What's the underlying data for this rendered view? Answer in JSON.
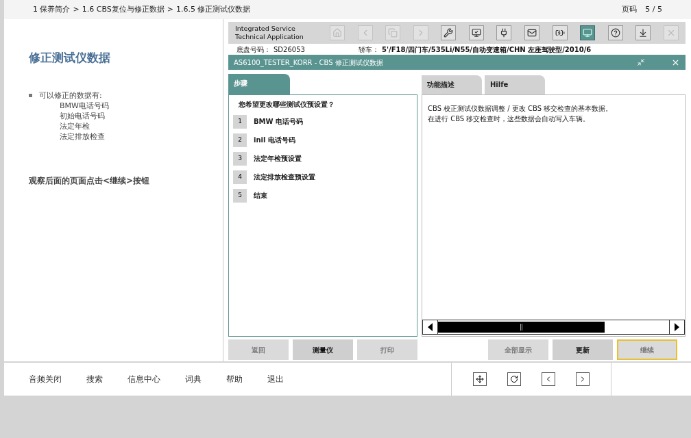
{
  "breadcrumb": [
    "1 保养简介",
    "1.6 CBS复位与修正数据",
    "1.6.5 修正测试仪数据"
  ],
  "breadcrumb_separator": ">",
  "page_label": "页码",
  "page_number": "5 / 5",
  "left": {
    "title": "修正测试仪数据",
    "intro": "可以修正的数据有:",
    "items": [
      "BMW电话号码",
      "初始电话号码",
      "法定年检",
      "法定排放检查"
    ],
    "instruction": "观察后面的页面点击<继续>按钮"
  },
  "app": {
    "brand": [
      "Integrated Service",
      "Technical Application"
    ],
    "toolbar": [
      {
        "kind": "home",
        "disabled": true,
        "selected": false
      },
      {
        "kind": "back",
        "disabled": true,
        "selected": false
      },
      {
        "kind": "copy",
        "disabled": true,
        "selected": false
      },
      {
        "kind": "forward",
        "disabled": true,
        "selected": false
      },
      {
        "kind": "wrench",
        "disabled": false,
        "selected": false
      },
      {
        "kind": "diagnosis",
        "disabled": false,
        "selected": false
      },
      {
        "kind": "plug",
        "disabled": false,
        "selected": false
      },
      {
        "kind": "mail",
        "disabled": false,
        "selected": false
      },
      {
        "kind": "battery",
        "disabled": false,
        "selected": false
      },
      {
        "kind": "screen",
        "disabled": false,
        "selected": true
      },
      {
        "kind": "help",
        "disabled": false,
        "selected": false
      },
      {
        "kind": "download",
        "disabled": false,
        "selected": false
      },
      {
        "kind": "close",
        "disabled": true,
        "selected": false
      }
    ],
    "vin_label": "底盘号码：",
    "vin": "SD26053",
    "vehicle_label": "轿车：",
    "vehicle": "5'/F18/四门车/535Li/N55/自动变速箱/CHN 左座驾驶型/2010/6",
    "dialog_title": "AS6100_TESTER_KORR - CBS 修正测试仪数据",
    "left_tabs": [
      {
        "label": "步骤",
        "selected": true
      }
    ],
    "right_tabs": [
      {
        "label": "功能描述",
        "selected": false
      },
      {
        "label": "Hilfe",
        "selected": false
      }
    ],
    "question": "您希望更改哪些测试仪预设置？",
    "steps": [
      {
        "number": "1",
        "label": "BMW 电话号码"
      },
      {
        "number": "2",
        "label": "inil 电话号码"
      },
      {
        "number": "3",
        "label": "法定年检预设置"
      },
      {
        "number": "4",
        "label": "法定排放检查预设置"
      },
      {
        "number": "5",
        "label": "结束"
      }
    ],
    "description": [
      "CBS 校正测试仪数据调整 / 更改 CBS 移交检查的基本数据。",
      "在进行 CBS 移交检查时，这些数据会自动写入车辆。"
    ],
    "left_buttons": [
      {
        "label": "返回",
        "disabled": true,
        "selected": false
      },
      {
        "label": "测量仪",
        "disabled": false,
        "selected": false
      },
      {
        "label": "打印",
        "disabled": true,
        "selected": false
      }
    ],
    "right_buttons": [
      {
        "label": "全部显示",
        "disabled": true,
        "selected": false
      },
      {
        "label": "更新",
        "disabled": false,
        "selected": false
      },
      {
        "label": "继续",
        "disabled": true,
        "selected": true
      }
    ]
  },
  "bottom_nav": [
    "音频关闭",
    "搜索",
    "信息中心",
    "词典",
    "帮助",
    "退出"
  ]
}
